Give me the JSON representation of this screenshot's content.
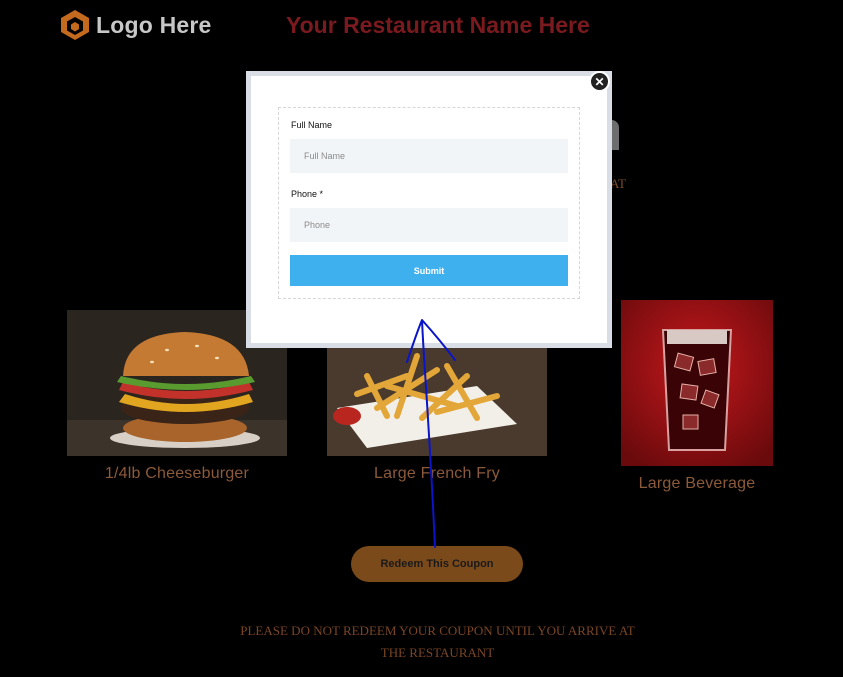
{
  "header": {
    "logo_text": "Logo Here",
    "restaurant_name": "Your Restaurant Name Here"
  },
  "background_hint": {
    "partial_text": "AT"
  },
  "items": [
    {
      "caption": "1/4lb Cheeseburger"
    },
    {
      "caption": "Large French Fry"
    },
    {
      "caption": "Large Beverage"
    }
  ],
  "redeem": {
    "label": "Redeem This Coupon"
  },
  "notice": {
    "line1": "PLEASE DO NOT REDEEM YOUR COUPON UNTIL YOU ARRIVE AT",
    "line2": "THE RESTAURANT"
  },
  "modal": {
    "close_icon": "✕",
    "fields": {
      "full_name": {
        "label": "Full Name",
        "placeholder": "Full Name",
        "value": ""
      },
      "phone": {
        "label": "Phone *",
        "placeholder": "Phone",
        "value": ""
      }
    },
    "submit_label": "Submit"
  },
  "colors": {
    "background": "#000000",
    "restaurant_name": "#7a1a1f",
    "logo_orange": "#c46a1f",
    "redeem_button": "#7b4a1a",
    "submit_button": "#3eb0ee",
    "annotation_arrow": "#0a14c8"
  },
  "icons": [
    "logo-hexagon-icon",
    "close-icon"
  ]
}
